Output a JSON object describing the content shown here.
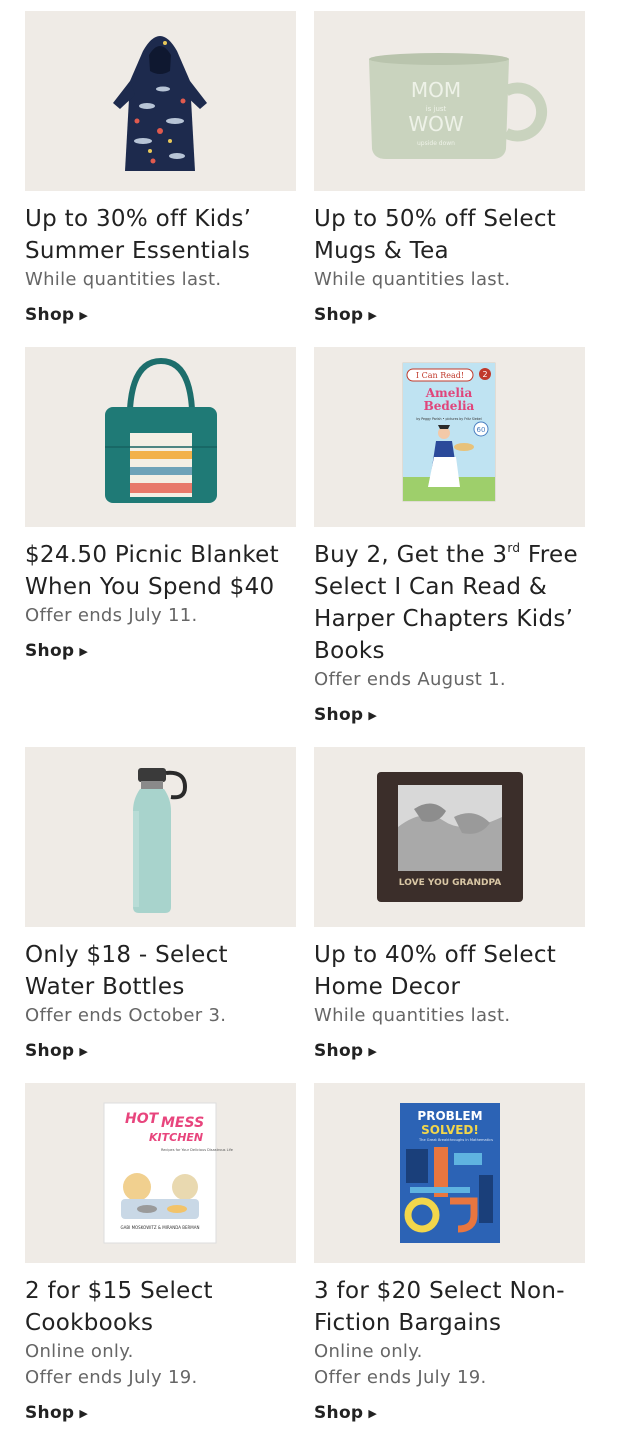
{
  "promos": [
    {
      "title": "Up to 30% off Kids’ Summer Essentials",
      "lines": [
        "While quantities last."
      ],
      "cta": "Shop",
      "image_icon": "hooded-towel-icon"
    },
    {
      "title": "Up to 50% off Select Mugs & Tea",
      "lines": [
        "While quantities last."
      ],
      "cta": "Shop",
      "image_icon": "mug-icon",
      "image_text": [
        "MOM",
        "is just",
        "WOW",
        "upside down"
      ]
    },
    {
      "title": "$24.50 Picnic Blanket When You Spend $40",
      "lines": [
        "Offer ends July 11."
      ],
      "cta": "Shop",
      "image_icon": "picnic-blanket-tote-icon"
    },
    {
      "title_pre": "Buy 2, Get the 3",
      "title_sup": "rd",
      "title_post": " Free Select I Can Read & Harper Chapters Kids’ Books",
      "lines": [
        "Offer ends August 1."
      ],
      "cta": "Shop",
      "image_icon": "book-cover-icon",
      "image_text": [
        "I Can Read!",
        "2",
        "Amelia",
        "Bedelia",
        "by Peggy Parish • pictures by Fritz Siebel",
        "60"
      ]
    },
    {
      "title": "Only $18 - Select Water Bottles",
      "lines": [
        "Offer ends October 3."
      ],
      "cta": "Shop",
      "image_icon": "water-bottle-icon"
    },
    {
      "title": "Up to 40% off Select Home Decor",
      "lines": [
        "While quantities last."
      ],
      "cta": "Shop",
      "image_icon": "picture-frame-icon",
      "image_text": [
        "LOVE YOU GRANDPA"
      ]
    },
    {
      "title": "2 for $15 Select Cookbooks",
      "lines": [
        "Online only.",
        "Offer ends July 19."
      ],
      "cta": "Shop",
      "image_icon": "cookbook-cover-icon",
      "image_text": [
        "HOT",
        "MESS",
        "KITCHEN",
        "Recipes for Your Delicious Disastrous Life",
        "GABI MOSKOWITZ & MIRANDA BERMAN"
      ]
    },
    {
      "title": "3 for $20 Select Non-Fiction Bargains",
      "lines": [
        "Online only.",
        "Offer ends July 19."
      ],
      "cta": "Shop",
      "image_icon": "book-cover-icon",
      "image_text": [
        "PROBLEM",
        "SOLVED!",
        "The Great Breakthroughs in Mathematics"
      ]
    }
  ],
  "colors": {
    "tile_background": "#efebe6",
    "text": "#222222",
    "subtext": "#666666"
  }
}
